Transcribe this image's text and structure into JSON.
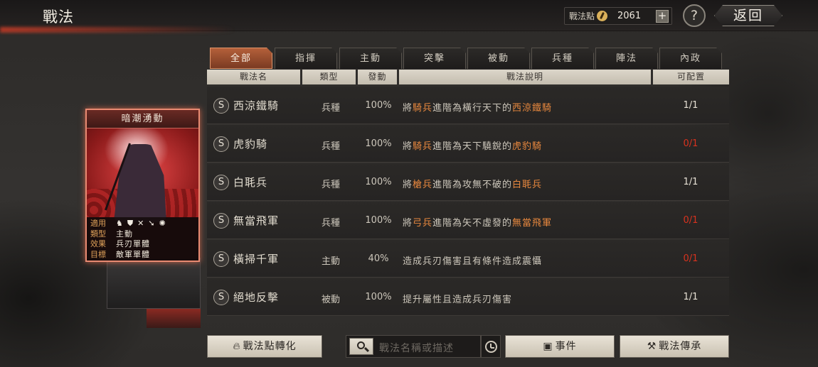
{
  "header": {
    "title": "戰法",
    "points_label": "戰法點",
    "points_value": "2061",
    "plus_label": "+",
    "help_label": "?",
    "back_label": "返回"
  },
  "tabs": [
    "全部",
    "指揮",
    "主動",
    "突擊",
    "被動",
    "兵種",
    "陣法",
    "內政"
  ],
  "active_tab": "全部",
  "columns": {
    "name": "戰法名",
    "type": "類型",
    "rate": "發動",
    "desc": "戰法說明",
    "slot": "可配置"
  },
  "rows": [
    {
      "badge": "S",
      "name": "西涼鐵騎",
      "type": "兵種",
      "rate": "100%",
      "desc_parts": [
        {
          "t": "將",
          "hl": false
        },
        {
          "t": "騎兵",
          "hl": true
        },
        {
          "t": "進階為橫行天下的",
          "hl": false
        },
        {
          "t": "西涼鐵騎",
          "hl": true
        }
      ],
      "slot": "1/1",
      "slot_full": false
    },
    {
      "badge": "S",
      "name": "虎豹騎",
      "type": "兵種",
      "rate": "100%",
      "desc_parts": [
        {
          "t": "將",
          "hl": false
        },
        {
          "t": "騎兵",
          "hl": true
        },
        {
          "t": "進階為天下驍銳的",
          "hl": false
        },
        {
          "t": "虎豹騎",
          "hl": true
        }
      ],
      "slot": "0/1",
      "slot_full": true
    },
    {
      "badge": "S",
      "name": "白毦兵",
      "type": "兵種",
      "rate": "100%",
      "desc_parts": [
        {
          "t": "將",
          "hl": false
        },
        {
          "t": "槍兵",
          "hl": true
        },
        {
          "t": "進階為攻無不破的",
          "hl": false
        },
        {
          "t": "白毦兵",
          "hl": true
        }
      ],
      "slot": "1/1",
      "slot_full": false
    },
    {
      "badge": "S",
      "name": "無當飛軍",
      "type": "兵種",
      "rate": "100%",
      "desc_parts": [
        {
          "t": "將",
          "hl": false
        },
        {
          "t": "弓兵",
          "hl": true
        },
        {
          "t": "進階為矢不虛發的",
          "hl": false
        },
        {
          "t": "無當飛軍",
          "hl": true
        }
      ],
      "slot": "0/1",
      "slot_full": true
    },
    {
      "badge": "S",
      "name": "橫掃千軍",
      "type": "主動",
      "rate": "40%",
      "desc_parts": [
        {
          "t": "造成兵刃傷害且有條件造成震懾",
          "hl": false
        }
      ],
      "slot": "0/1",
      "slot_full": true
    },
    {
      "badge": "S",
      "name": "絕地反擊",
      "type": "被動",
      "rate": "100%",
      "desc_parts": [
        {
          "t": "提升屬性且造成兵刃傷害",
          "hl": false
        }
      ],
      "slot": "1/1",
      "slot_full": false
    }
  ],
  "card": {
    "title": "暗潮湧動",
    "applies_label": "適用",
    "applies_icons": [
      "cavalry-icon",
      "shield-icon",
      "bow-icon",
      "spear-icon",
      "siege-icon"
    ],
    "type_label": "類型",
    "type_value": "主動",
    "effect_label": "效果",
    "effect_value": "兵刃單體",
    "target_label": "目標",
    "target_value": "敵軍單體"
  },
  "footer": {
    "convert_label": "戰法點轉化",
    "search_placeholder": "戰法名稱或描述",
    "events_label": "事件",
    "inherit_label": "戰法傳承"
  },
  "colors": {
    "accent_tab": "#b4603a",
    "highlight": "#e8883e",
    "slot_full": "#d8321e"
  }
}
